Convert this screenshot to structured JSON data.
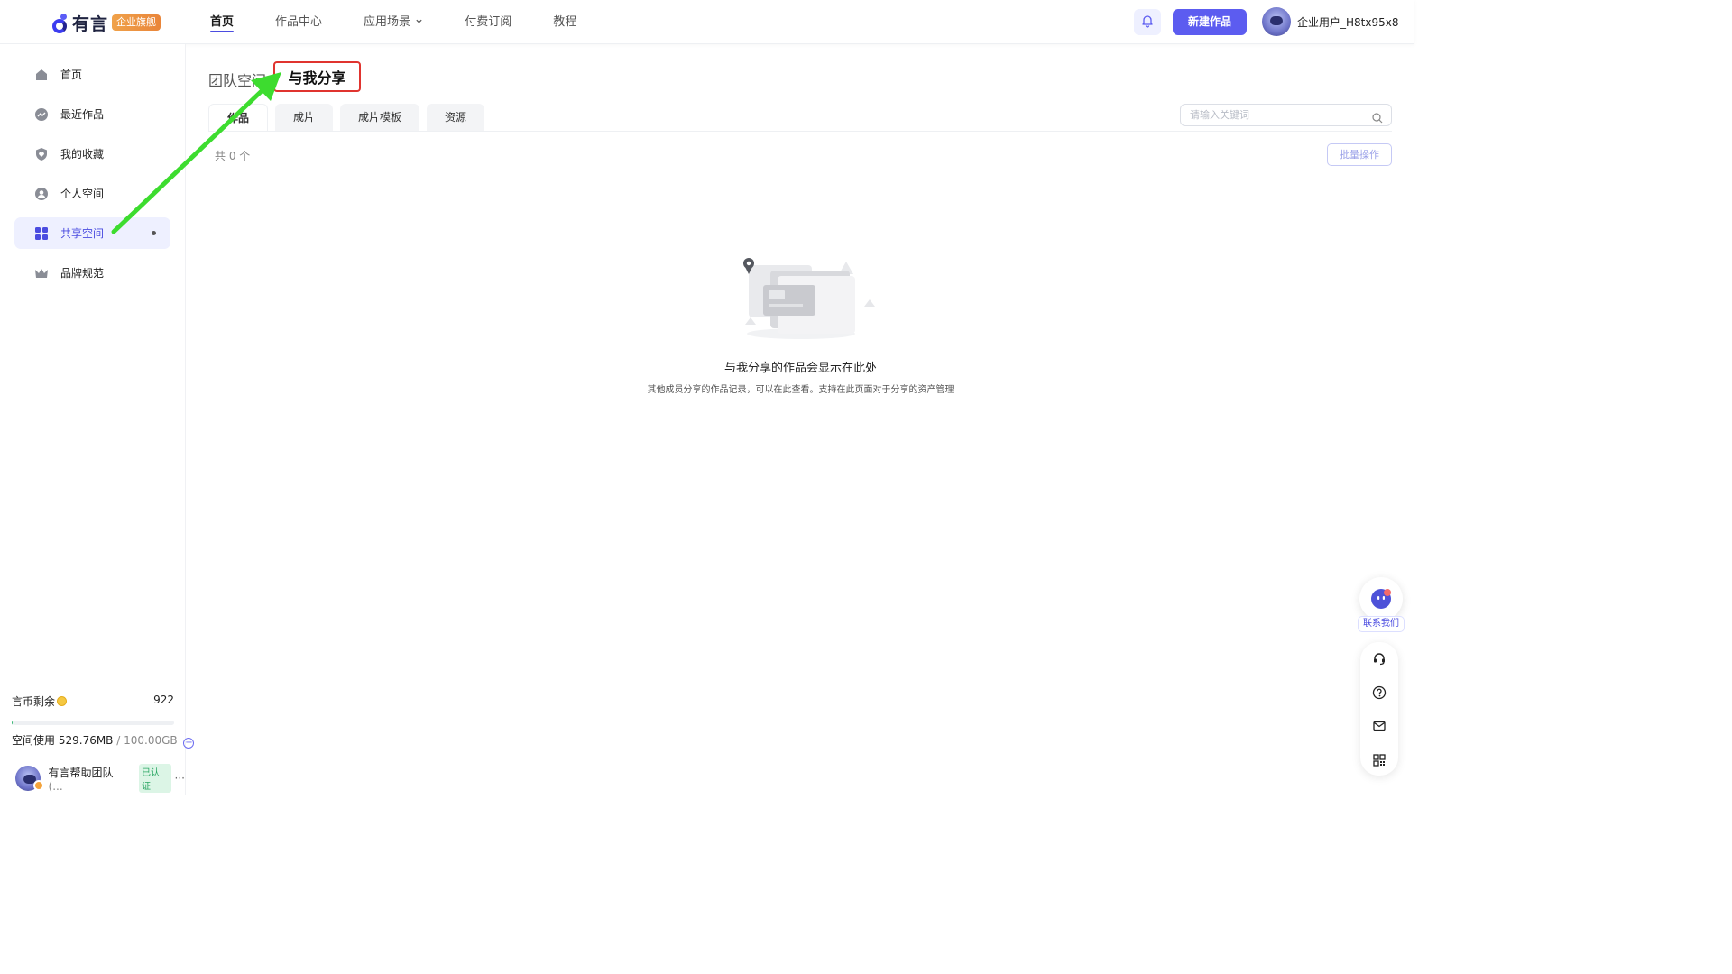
{
  "header": {
    "logo_text": "有言",
    "badge": "企业旗舰",
    "nav": [
      {
        "label": "首页",
        "active": true
      },
      {
        "label": "作品中心"
      },
      {
        "label": "应用场景"
      },
      {
        "label": "付费订阅"
      },
      {
        "label": "教程"
      }
    ],
    "new_button": "新建作品",
    "user_name": "企业用户_H8tx95x8"
  },
  "sidebar": {
    "items": [
      {
        "label": "首页",
        "icon": "home-icon"
      },
      {
        "label": "最近作品",
        "icon": "trend-icon"
      },
      {
        "label": "我的收藏",
        "icon": "heart-shield-icon"
      },
      {
        "label": "个人空间",
        "icon": "person-icon"
      },
      {
        "label": "共享空间",
        "icon": "grid-icon",
        "active": true
      },
      {
        "label": "品牌规范",
        "icon": "crown-icon"
      }
    ],
    "coins_label": "言币剩余",
    "coins_value": "922",
    "storage_label": "空间使用",
    "storage_used": "529.76MB",
    "storage_total": "/ 100.00GB",
    "storage_used_fraction": 0.005,
    "team_name": "有言帮助团队",
    "team_more": "(...",
    "team_badge": "已认证"
  },
  "main": {
    "space_tabs": [
      "团队空间",
      "与我分享"
    ],
    "content_tabs": [
      "作品",
      "成片",
      "成片模板",
      "资源"
    ],
    "search_placeholder": "请输入关键词",
    "count": "共 0 个",
    "batch_button": "批量操作",
    "empty_title": "与我分享的作品会显示在此处",
    "empty_subtitle": "其他成员分享的作品记录，可以在此查看。支持在此页面对于分享的资产管理"
  },
  "float": {
    "contact_label": "联系我们",
    "buttons": [
      "headset-icon",
      "help-icon",
      "mail-icon",
      "qrcode-icon"
    ]
  },
  "colors": {
    "accent": "#5c5cf0",
    "highlight_box": "#e0342f",
    "arrow": "#3ddc2f"
  }
}
